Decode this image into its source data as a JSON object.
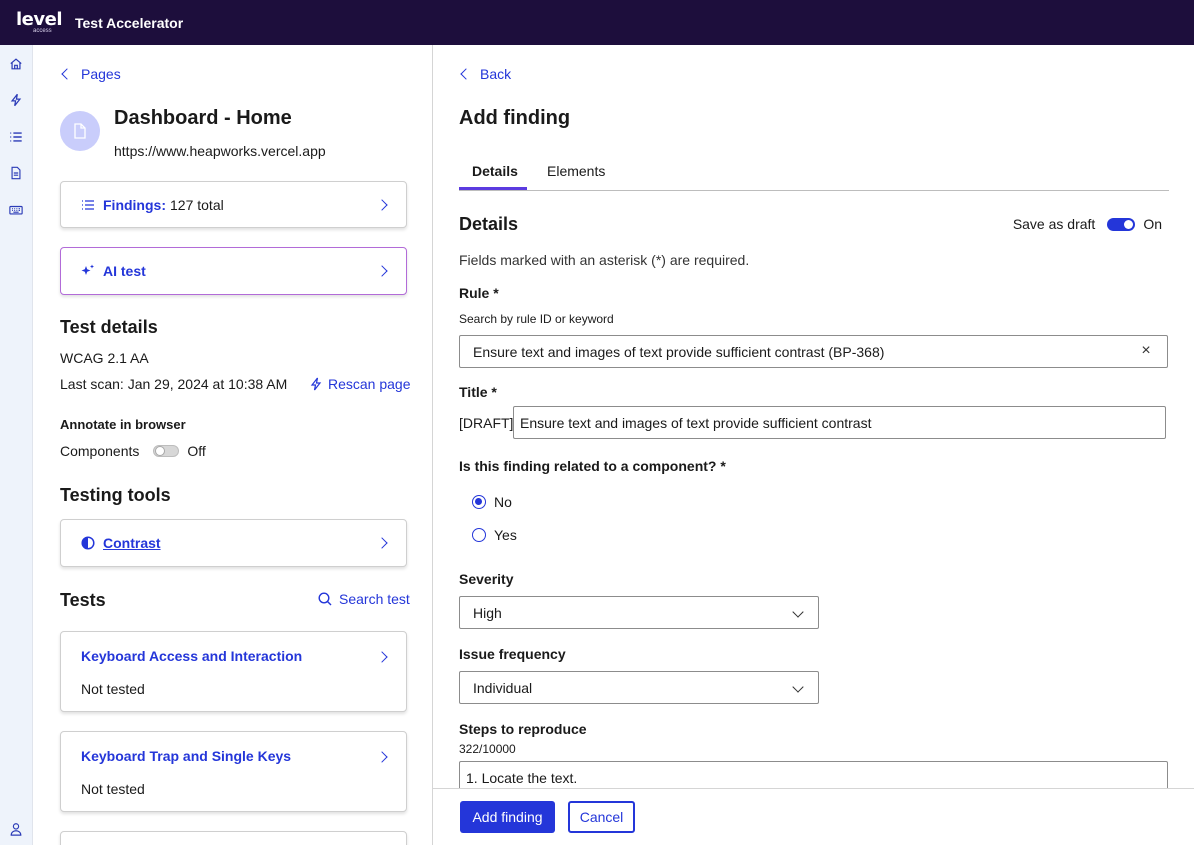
{
  "app": {
    "logo": "level",
    "logo_sub": "access",
    "title": "Test Accelerator"
  },
  "rail": {
    "icons": [
      "home-icon",
      "lightning-icon",
      "list-icon",
      "document-icon",
      "keyboard-icon",
      "user-icon"
    ]
  },
  "left": {
    "back_label": "Pages",
    "page_title": "Dashboard - Home",
    "page_url": "https://www.heapworks.vercel.app",
    "findings_label": "Findings:",
    "findings_count": "127 total",
    "ai_test_label": "AI test",
    "test_details_heading": "Test details",
    "standard": "WCAG 2.1 AA",
    "last_scan": "Last scan: Jan 29, 2024 at 10:38 AM",
    "rescan_label": "Rescan page",
    "annotate_heading": "Annotate in browser",
    "components_label": "Components",
    "components_state": "Off",
    "testing_tools_heading": "Testing tools",
    "contrast_label": "Contrast",
    "tests_heading": "Tests",
    "search_test_label": "Search test",
    "tests": [
      {
        "name": "Keyboard Access and Interaction",
        "status": "Not tested"
      },
      {
        "name": "Keyboard Trap and Single Keys",
        "status": "Not tested"
      }
    ]
  },
  "right": {
    "back_label": "Back",
    "title": "Add finding",
    "tabs": [
      "Details",
      "Elements"
    ],
    "section_heading": "Details",
    "draft_label": "Save as draft",
    "draft_state": "On",
    "required_note": "Fields marked with an asterisk (*) are required.",
    "rule_label": "Rule *",
    "rule_hint": "Search by rule ID or keyword",
    "rule_value": "Ensure text and images of text provide sufficient contrast (BP-368)",
    "title_label": "Title *",
    "title_prefix": "[DRAFT]",
    "title_value": "Ensure text and images of text provide sufficient contrast",
    "component_question": "Is this finding related to a component? *",
    "radio_no": "No",
    "radio_yes": "Yes",
    "severity_label": "Severity",
    "severity_value": "High",
    "frequency_label": "Issue frequency",
    "frequency_value": "Individual",
    "steps_label": "Steps to reproduce",
    "steps_count": "322/10000",
    "steps_value": "1. Locate the text."
  },
  "footer": {
    "primary_label": "Add finding",
    "secondary_label": "Cancel"
  },
  "colors": {
    "topbar": "#1d0e3c",
    "accent": "#2436d9",
    "tab_underline": "#5b3be0"
  }
}
